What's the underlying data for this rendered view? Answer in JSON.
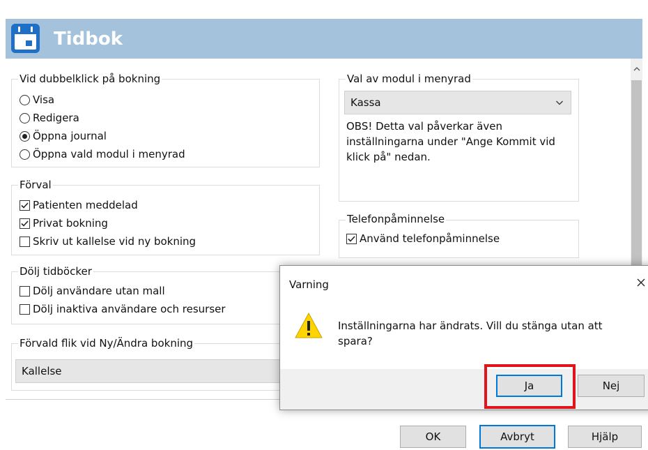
{
  "header": {
    "title": "Tidbok",
    "color": "#a4c2dc"
  },
  "group_dblclick": {
    "title": "Vid dubbelklick på bokning",
    "options": [
      "Visa",
      "Redigera",
      "Öppna journal",
      "Öppna vald modul i menyrad"
    ],
    "selected": "Öppna journal"
  },
  "group_preset": {
    "title": "Förval",
    "options": [
      {
        "label": "Patienten meddelad",
        "checked": true
      },
      {
        "label": "Privat bokning",
        "checked": true
      },
      {
        "label": "Skriv ut kallelse vid ny bokning",
        "checked": false
      }
    ]
  },
  "group_hide": {
    "title": "Dölj tidböcker",
    "options": [
      {
        "label": "Dölj användare utan mall",
        "checked": false
      },
      {
        "label": "Dölj inaktiva användare och resurser",
        "checked": false
      }
    ]
  },
  "group_default_tab": {
    "title": "Förvald flik vid Ny/Ändra bokning",
    "value": "Kallelse"
  },
  "group_module": {
    "title": "Val av modul i menyrad",
    "value": "Kassa",
    "note": "OBS! Detta val påverkar även inställningarna under \"Ange Kommit vid klick på\" nedan."
  },
  "group_phone": {
    "title": "Telefonpåminnelse",
    "option": {
      "label": "Använd telefonpåminnelse",
      "checked": true
    }
  },
  "footer": {
    "ok_label": "OK",
    "cancel_label": "Avbryt",
    "help_label": "Hjälp"
  },
  "dialog": {
    "title": "Varning",
    "message": "Inställningarna har ändrats. Vill du stänga utan att spara?",
    "yes_label": "Ja",
    "no_label": "Nej",
    "highlight_color": "#e0141b"
  }
}
